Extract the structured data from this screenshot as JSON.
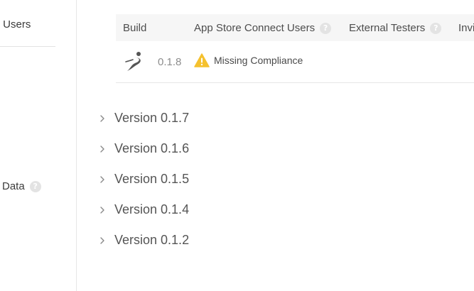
{
  "sidebar": {
    "users_label": "ect Users",
    "data_label": "Data",
    "data_help": "?"
  },
  "table": {
    "headers": {
      "build": "Build",
      "asc_users": "App Store Connect Users",
      "asc_users_help": "?",
      "external": "External Testers",
      "external_help": "?",
      "invites": "Invi"
    },
    "rows": [
      {
        "build_number": "0.1.8",
        "status": "Missing Compliance",
        "status_color": "#f5c12e"
      }
    ]
  },
  "versions": [
    {
      "label": "Version 0.1.7"
    },
    {
      "label": "Version 0.1.6"
    },
    {
      "label": "Version 0.1.5"
    },
    {
      "label": "Version 0.1.4"
    },
    {
      "label": "Version 0.1.2"
    }
  ],
  "icons": {
    "build": "app-build-icon",
    "warning": "warning-icon",
    "chevron": "chevron-right-icon",
    "help": "help-icon"
  }
}
